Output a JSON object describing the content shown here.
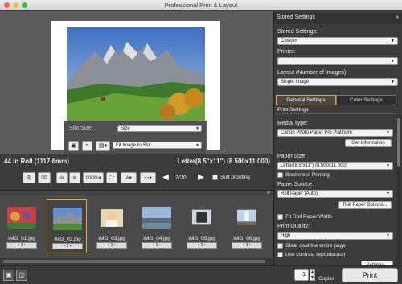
{
  "window": {
    "title": "Professional Print & Layout"
  },
  "preview": {
    "slot_size_label": "Slot Size:",
    "slot_size_value": "Size",
    "fit_value": "Fit Image to Slot"
  },
  "info": {
    "roll": "44 in Roll (1117.6mm)",
    "paper": "Letter(8.5\"x11\") (8.500x11.000)"
  },
  "toolbar": {
    "zoom": "100%",
    "page": "2/20",
    "soft_proofing": "Soft proofing"
  },
  "thumbnails": [
    {
      "name": "IMG_01.jpg",
      "count": "1"
    },
    {
      "name": "IMG_02.jpg",
      "count": "1"
    },
    {
      "name": "IMG_03.jpg",
      "count": "1"
    },
    {
      "name": "IMG_04.jpg",
      "count": "1"
    },
    {
      "name": "IMG_05.jpg",
      "count": "1"
    },
    {
      "name": "IMG_06.jpg",
      "count": "1"
    }
  ],
  "panel": {
    "header": "Stored Settings",
    "stored_label": "Stored Settings:",
    "stored_value": "Custom",
    "printer_label": "Printer:",
    "printer_value": "",
    "layout_label": "Layout (Number of Images)",
    "layout_value": "Single Image",
    "tab_general": "General Settings",
    "tab_color": "Color Settings",
    "print_settings": "Print Settings",
    "media_label": "Media Type:",
    "media_value": "Canon Photo Paper Pro Platinum",
    "get_info": "Get Information",
    "paper_size_label": "Paper Size:",
    "paper_size_value": "Letter(8.5\"x11\") (8.500x11.000)",
    "borderless": "Borderless Printing",
    "paper_source_label": "Paper Source:",
    "paper_source_value": "Roll Paper (Auto)",
    "roll_options": "Roll Paper Options...",
    "fit_roll": "Fit Roll Paper Width",
    "quality_label": "Print Quality:",
    "quality_value": "High",
    "clear_coat": "Clear coat the entire page",
    "contrast": "Use contrast reproduction",
    "settings_btn": "Settings..."
  },
  "bottom": {
    "copies_value": "1",
    "copies_label": "Copies",
    "print": "Print"
  },
  "colors": {
    "accent": "#e8a33c",
    "panel": "#3c3c3c",
    "preview": "#5c5c5c"
  }
}
